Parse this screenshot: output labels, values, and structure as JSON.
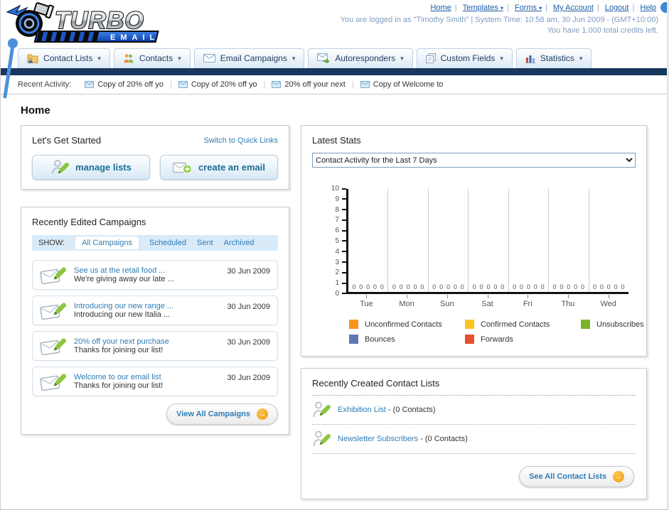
{
  "brand": {
    "name": "TURBO",
    "sub": "EMAIL"
  },
  "header": {
    "separator": "|",
    "links": [
      {
        "label": "Home",
        "dropdown": false
      },
      {
        "label": "Templates",
        "dropdown": true
      },
      {
        "label": "Forms",
        "dropdown": true
      },
      {
        "label": "My Account",
        "dropdown": false
      },
      {
        "label": "Logout",
        "dropdown": false
      },
      {
        "label": "Help",
        "dropdown": false
      }
    ],
    "login_info": "You are logged in as \"Timothy Smith\" | System Time: 10:58 am, 30 Jun 2009 - (GMT+10:00)",
    "credits_info": "You have 1,000 total credits left."
  },
  "nav": {
    "tabs": [
      {
        "label": "Contact Lists",
        "icon": "contact-lists-icon"
      },
      {
        "label": "Contacts",
        "icon": "contacts-icon"
      },
      {
        "label": "Email Campaigns",
        "icon": "email-campaigns-icon"
      },
      {
        "label": "Autoresponders",
        "icon": "autoresponders-icon"
      },
      {
        "label": "Custom Fields",
        "icon": "custom-fields-icon"
      },
      {
        "label": "Statistics",
        "icon": "statistics-icon"
      }
    ]
  },
  "recent_activity": {
    "label": "Recent Activity:",
    "items": [
      "Copy of 20% off yo",
      "Copy of 20% off yo",
      "20% off your next",
      "Copy of Welcome to"
    ]
  },
  "page_title": "Home",
  "get_started": {
    "title": "Let's Get Started",
    "switch_link": "Switch to Quick Links",
    "buttons": [
      {
        "label": "manage lists",
        "icon": "manage-lists-icon"
      },
      {
        "label": "create an email",
        "icon": "create-email-icon"
      }
    ]
  },
  "campaigns": {
    "title": "Recently Edited Campaigns",
    "show_label": "SHOW:",
    "filters": [
      "All Campaigns",
      "Scheduled",
      "Sent",
      "Archived"
    ],
    "active_filter": "All Campaigns",
    "rows": [
      {
        "title": "See us at the retail food ...",
        "subtitle": "We're giving away our late ...",
        "date": "30 Jun 2009"
      },
      {
        "title": "Introducing our new range ...",
        "subtitle": "Introducing our new Italia ...",
        "date": "30 Jun 2009"
      },
      {
        "title": "20% off your next purchase",
        "subtitle": "Thanks for joining our list!",
        "date": "30 Jun 2009"
      },
      {
        "title": "Welcome to our email list",
        "subtitle": "Thanks for joining our list!",
        "date": "30 Jun 2009"
      }
    ],
    "view_all_label": "View All Campaigns"
  },
  "stats": {
    "title": "Latest Stats",
    "dropdown_value": "Contact Activity for the Last 7 Days"
  },
  "chart_data": {
    "type": "bar",
    "title": "Contact Activity for the Last 7 Days",
    "categories": [
      "Tue",
      "Mon",
      "Sun",
      "Sat",
      "Fri",
      "Thu",
      "Wed"
    ],
    "series": [
      {
        "name": "Unconfirmed Contacts",
        "color": "#F7941E",
        "values": [
          0,
          0,
          0,
          0,
          0,
          0,
          0
        ]
      },
      {
        "name": "Confirmed Contacts",
        "color": "#FCC41D",
        "values": [
          0,
          0,
          0,
          0,
          0,
          0,
          0
        ]
      },
      {
        "name": "Unsubscribes",
        "color": "#7CB32C",
        "values": [
          0,
          0,
          0,
          0,
          0,
          0,
          0
        ]
      },
      {
        "name": "Bounces",
        "color": "#5C79B2",
        "values": [
          0,
          0,
          0,
          0,
          0,
          0,
          0
        ]
      },
      {
        "name": "Forwards",
        "color": "#E6502C",
        "values": [
          0,
          0,
          0,
          0,
          0,
          0,
          0
        ]
      }
    ],
    "ylim": [
      0,
      10
    ],
    "ytick_step": 1,
    "value_labels_shown": true,
    "grid": "vertical-only",
    "legend_position": "bottom"
  },
  "contact_lists": {
    "title": "Recently Created Contact Lists",
    "items": [
      {
        "name": "Exhibition List",
        "suffix": " - (0 Contacts)"
      },
      {
        "name": "Newsletter Subscribers",
        "suffix": " - (0 Contacts)"
      }
    ],
    "see_all_label": "See All Contact Lists"
  },
  "colors": {
    "navy_bar": "#17375E",
    "link_blue": "#2F7CB5",
    "header_link_blue": "#1C5DA8",
    "login_text": "#7F9DC1",
    "button_text": "#1B6E96",
    "arrow_badge": "#F29D13",
    "show_bar_bg": "#D9EAF8"
  }
}
